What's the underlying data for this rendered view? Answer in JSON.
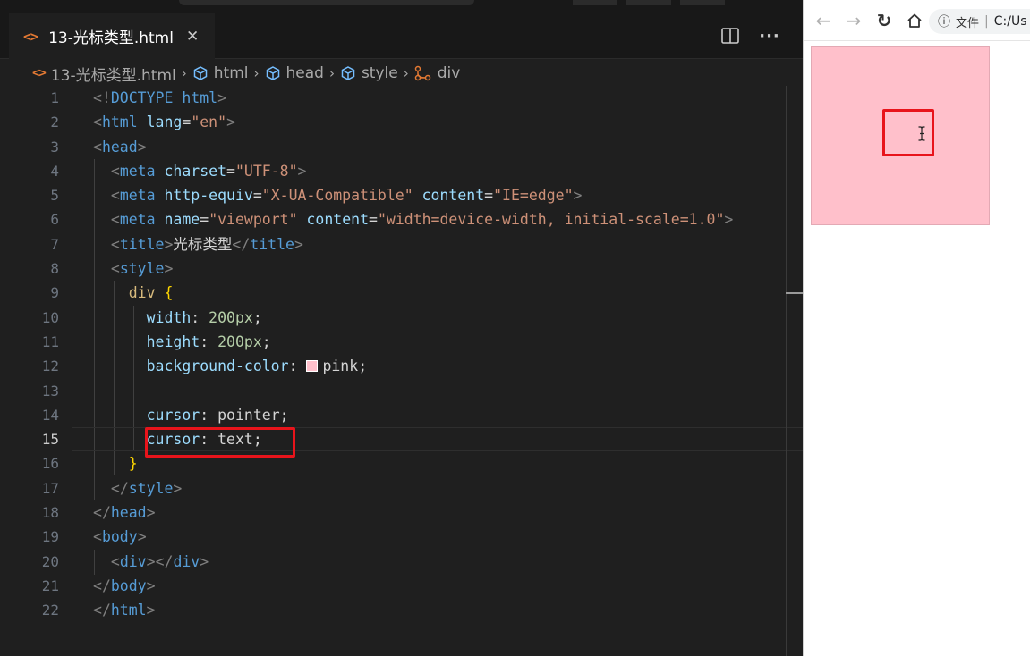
{
  "editor": {
    "tab": {
      "icon": "<>",
      "label": "13-光标类型.html",
      "close": "✕"
    },
    "actions": [
      {
        "name": "split-editor-icon"
      },
      {
        "name": "more-actions-icon",
        "glyph": "···"
      }
    ],
    "breadcrumb": [
      {
        "icon": "html-file-icon",
        "label": "13-光标类型.html"
      },
      {
        "icon": "cube-icon",
        "label": "html"
      },
      {
        "icon": "cube-icon",
        "label": "head"
      },
      {
        "icon": "cube-icon",
        "label": "style"
      },
      {
        "icon": "div-element-icon",
        "label": "div"
      }
    ],
    "current_line": 15,
    "lines": [
      "<!DOCTYPE html>",
      "<html lang=\"en\">",
      "<head>",
      "  <meta charset=\"UTF-8\">",
      "  <meta http-equiv=\"X-UA-Compatible\" content=\"IE=edge\">",
      "  <meta name=\"viewport\" content=\"width=device-width, initial-scale=1.0\">",
      "  <title>光标类型</title>",
      "  <style>",
      "    div {",
      "      width: 200px;",
      "      height: 200px;",
      "      background-color: pink;",
      "",
      "      cursor: pointer;",
      "      cursor: text;",
      "    }",
      "  </style>",
      "</head>",
      "<body>",
      "  <div></div>",
      "</body>",
      "</html>"
    ],
    "line_numbers": [
      "1",
      "2",
      "3",
      "4",
      "5",
      "6",
      "7",
      "8",
      "9",
      "10",
      "11",
      "12",
      "13",
      "14",
      "15",
      "16",
      "17",
      "18",
      "19",
      "20",
      "21",
      "22"
    ]
  },
  "browser": {
    "nav": [
      {
        "name": "back-arrow-icon",
        "glyph": "←"
      },
      {
        "name": "forward-arrow-icon",
        "glyph": "→"
      },
      {
        "name": "reload-icon",
        "glyph": "↻"
      },
      {
        "name": "home-icon"
      }
    ],
    "address": {
      "info_icon": "ⓘ",
      "label": "文件",
      "divider": "|",
      "url": "C:/Us"
    },
    "preview": {
      "element": "div",
      "background": "#ffc0cb",
      "cursor": "text"
    }
  },
  "colors": {
    "editor_bg": "#1f1f1f",
    "highlight_red": "#e8141b",
    "pink": "#ffc0cb"
  }
}
